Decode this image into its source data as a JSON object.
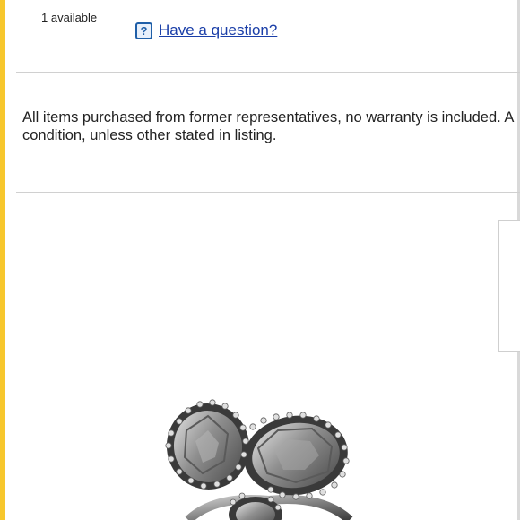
{
  "listing": {
    "availability": "1 available",
    "question_link": "Have a question?",
    "question_icon": "question-mark-icon",
    "notice_line1": "All items purchased from former representatives, no warranty is included. A",
    "notice_line2": "condition, unless other stated in listing."
  },
  "colors": {
    "accent": "#f7c72d",
    "link": "#1a3ea8",
    "divider": "#d0d0d0"
  },
  "image": {
    "subject": "silver ring with hammered stones and pavé crystal halos"
  }
}
